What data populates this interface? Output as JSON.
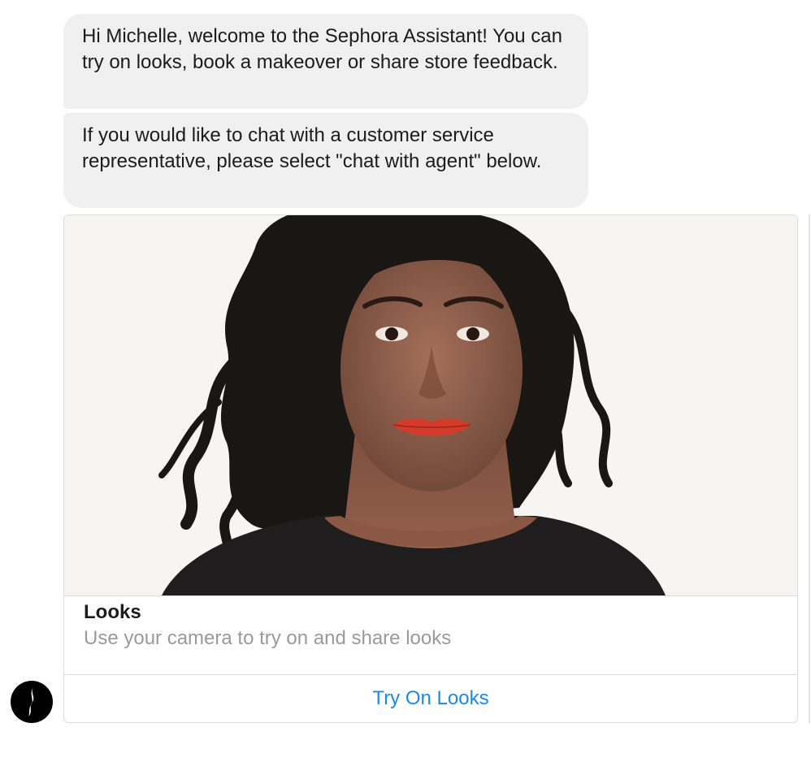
{
  "messages": [
    {
      "text": "Hi Michelle, welcome to the Sephora Assistant! You can try on looks, book a makeover or share store feedback."
    },
    {
      "text": "If you would like to chat with a customer service representative, please select \"chat with agent\" below."
    }
  ],
  "card": {
    "image_icon": "portrait-photo",
    "title": "Looks",
    "subtitle": "Use your camera to try on and share looks",
    "button_label": "Try On Looks"
  },
  "avatar": {
    "icon": "sephora-logo-icon"
  },
  "colors": {
    "bubble_bg": "#f0f0f0",
    "link_blue": "#1a8ae6",
    "subtitle_gray": "#9a9a9a",
    "border": "#dcdcdc"
  }
}
